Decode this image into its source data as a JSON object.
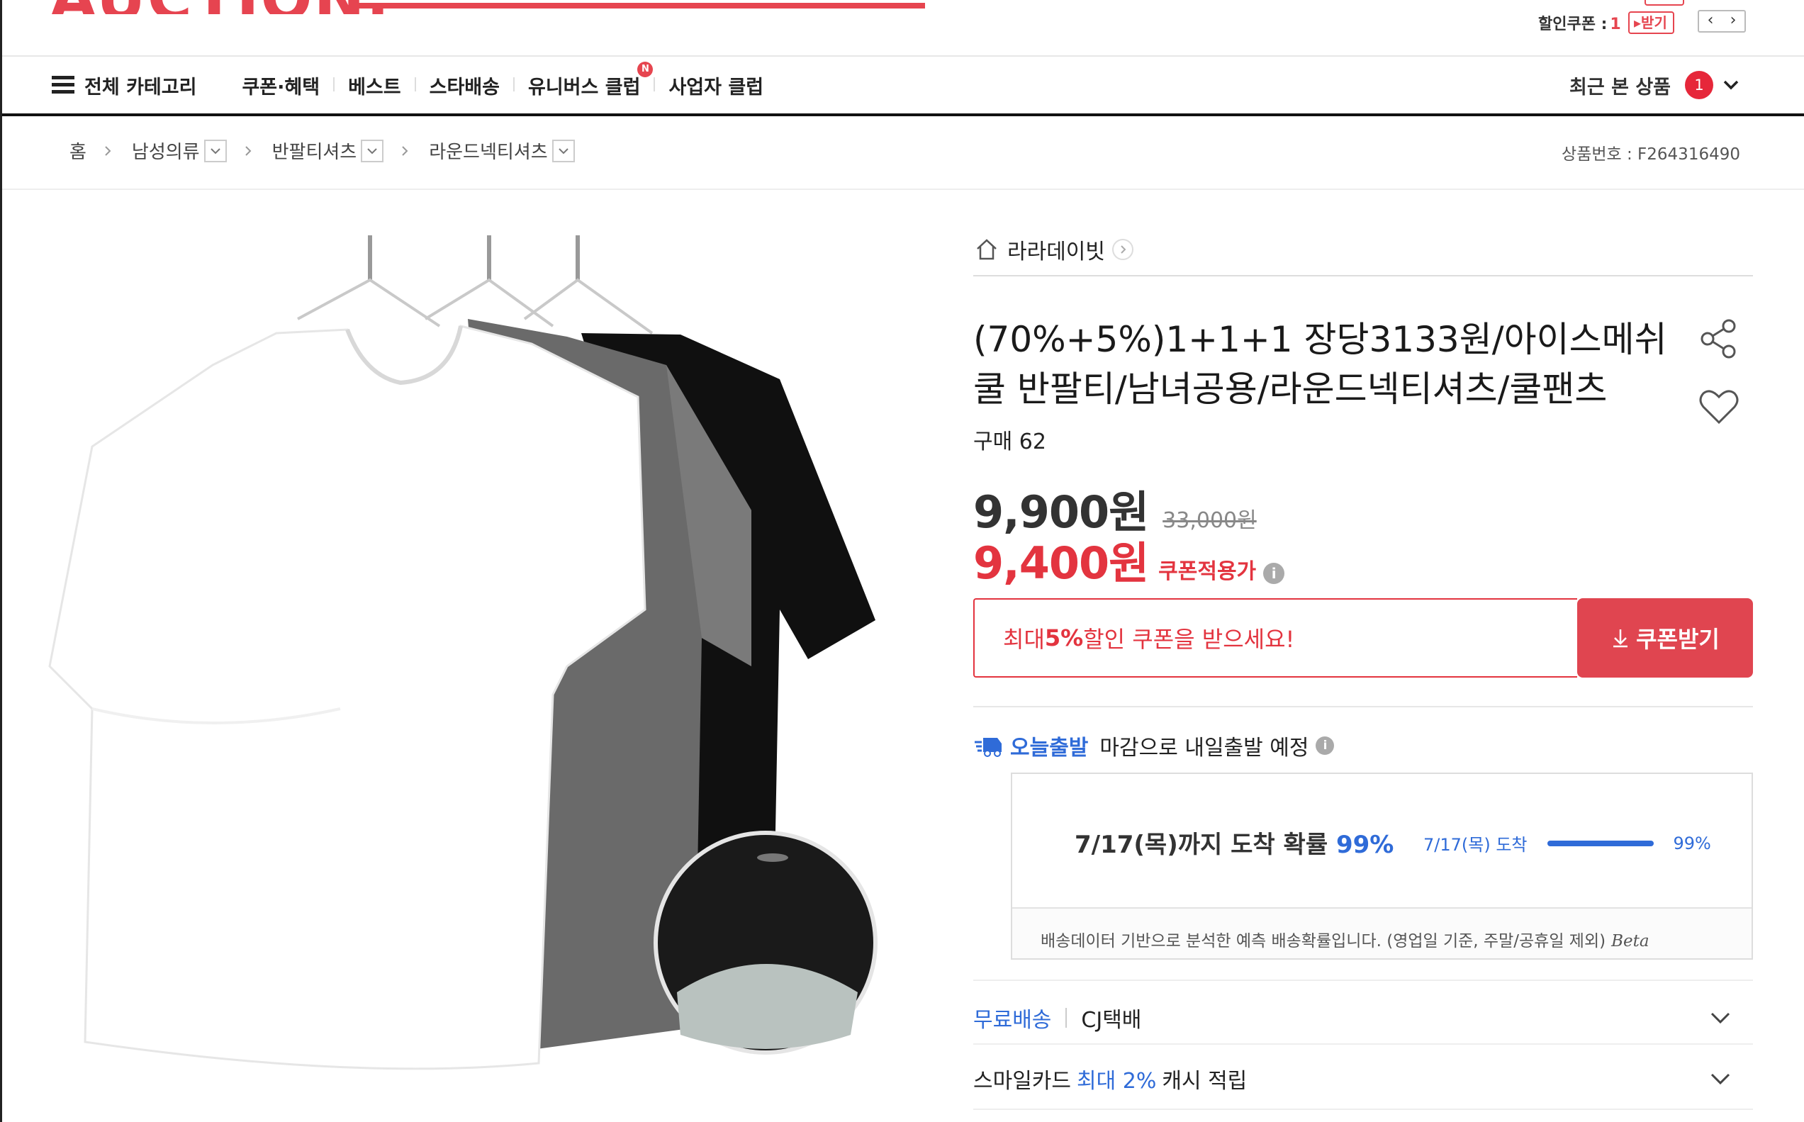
{
  "header": {
    "logo_text": "AUCTION.",
    "coupon_label": "할인쿠폰 :",
    "coupon_count": "1",
    "coupon_get": "받기",
    "pager_prev": "‹",
    "pager_next": "›"
  },
  "nav": {
    "all_categories": "전체 카테고리",
    "items": [
      "쿠폰·혜택",
      "베스트",
      "스타배송",
      "유니버스 클럽",
      "사업자 클럽"
    ],
    "new_badge": "N",
    "recent_label": "최근 본 상품",
    "recent_count": "1"
  },
  "breadcrumb": {
    "home": "홈",
    "levels": [
      "남성의류",
      "반팔티셔츠",
      "라운드넥티셔츠"
    ],
    "product_no": "상품번호 : F264316490"
  },
  "product": {
    "seller": "라라데이빗",
    "title": "(70%+5%)1+1+1 장당3133원/아이스메쉬쿨 반팔티/남녀공용/라운드넥티셔츠/쿨팬츠",
    "purchases": "구매 62",
    "price": "9,900원",
    "original_price": "33,000원",
    "coupon_price": "9,400원",
    "coupon_price_label": "쿠폰적용가",
    "coupon_msg_pre": "최대 ",
    "coupon_msg_pct": "5%",
    "coupon_msg_post": " 할인 쿠폰을 받으세요!",
    "coupon_button": "쿠폰받기"
  },
  "shipping": {
    "today_label": "오늘출발",
    "today_text": "마감으로 내일출발 예정",
    "prob_title_pre": "7/17(목)까지 도착 확률 ",
    "prob_pct": "99%",
    "prob_line_label": "7/17(목) 도착",
    "prob_line_pct": "99%",
    "prob_value": 0.99,
    "prob_note": "배송데이터 기반으로 분석한 예측 배송확률입니다. (영업일 기준, 주말/공휴일 제외)",
    "prob_beta": "Beta",
    "free_label": "무료배송",
    "carrier": "CJ택배",
    "card_pre": "스마일카드",
    "card_hl": "최대 2%",
    "card_post": "캐시 적립"
  },
  "colors": {
    "brand_red": "#e3343f",
    "accent_blue": "#2f6bd8"
  }
}
